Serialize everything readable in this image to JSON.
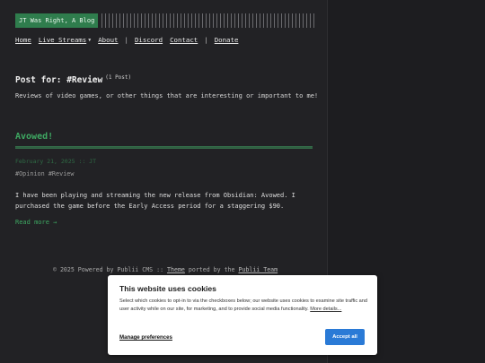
{
  "site": {
    "logo_text": "JT Was Right, A Blog"
  },
  "nav": {
    "home": "Home",
    "live_streams": "Live Streams",
    "about": "About",
    "separator": "|",
    "discord": "Discord",
    "contact": "Contact",
    "donate": "Donate"
  },
  "tag_page": {
    "heading": "Post for: #Review",
    "count": "(1 Post)",
    "description": "Reviews of video games, or other things that are interesting or important to me!"
  },
  "post": {
    "title": "Avowed!",
    "meta": "February 21, 2025 :: JT",
    "tags": "#Opinion #Review",
    "excerpt": "I have been playing and streaming the new release from Obsidian: Avowed. I purchased the game before the Early Access period for a staggering $90.",
    "read_more": "Read more →"
  },
  "footer": {
    "prefix": "© 2025 Powered by Publii CMS :: ",
    "theme_link": "Theme",
    "middle": " ported by the ",
    "team_link": "Publii Team"
  },
  "cookie": {
    "title": "This website uses cookies",
    "text": "Select which cookies to opt-in to via the checkboxes below; our website uses cookies to examine site traffic and user activity while on our site, for marketing, and to provide social media functionality. ",
    "more_link": "More details...",
    "manage": "Manage preferences",
    "accept": "Accept all"
  },
  "colors": {
    "background": "#222225",
    "accent_green": "#3ea862",
    "logo_bg": "#2f7d4d",
    "button_blue": "#2a7ad6"
  }
}
